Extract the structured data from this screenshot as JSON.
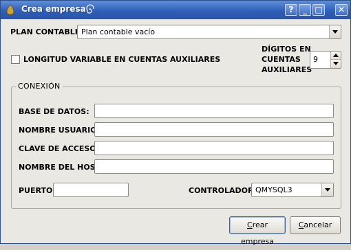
{
  "window": {
    "title": "Crea empresa",
    "buttons": {
      "help": "?",
      "minimize": "_",
      "maximize": "□",
      "close": "✕"
    }
  },
  "plan_contable": {
    "label": "PLAN CONTABLE:",
    "selected": "Plan contable vacío"
  },
  "longitud_variable": {
    "label": "LONGITUD VARIABLE EN CUENTAS AUXILIARES",
    "checked": false
  },
  "digitos": {
    "label_line1": "DÍGITOS EN",
    "label_line2": "CUENTAS",
    "label_line3": "AUXILIARES",
    "value": "9"
  },
  "conexion": {
    "title": "CONEXIÓN",
    "base_datos_label": "BASE DE DATOS:",
    "base_datos_value": "",
    "nombre_usuario_label": "NOMBRE USUARIO:",
    "nombre_usuario_value": "",
    "clave_acceso_label": "CLAVE DE ACCESO:",
    "clave_acceso_value": "",
    "nombre_host_label": "NOMBRE DEL HOST:",
    "nombre_host_value": "",
    "puerto_label": "PUERTO:",
    "puerto_value": "",
    "controlador_label": "CONTROLADOR:",
    "controlador_selected": "QMYSQL3"
  },
  "actions": {
    "crear_first": "C",
    "crear_rest": "rear empresa",
    "cancelar_first": "C",
    "cancelar_rest": "ancelar"
  },
  "colors": {
    "titlebar": "#2f5fb8",
    "window_bg": "#eae8e3"
  },
  "icons": [
    "app-icon",
    "spiral-icon",
    "help-icon",
    "minimize-icon",
    "maximize-icon",
    "close-icon",
    "chevron-down-icon"
  ]
}
